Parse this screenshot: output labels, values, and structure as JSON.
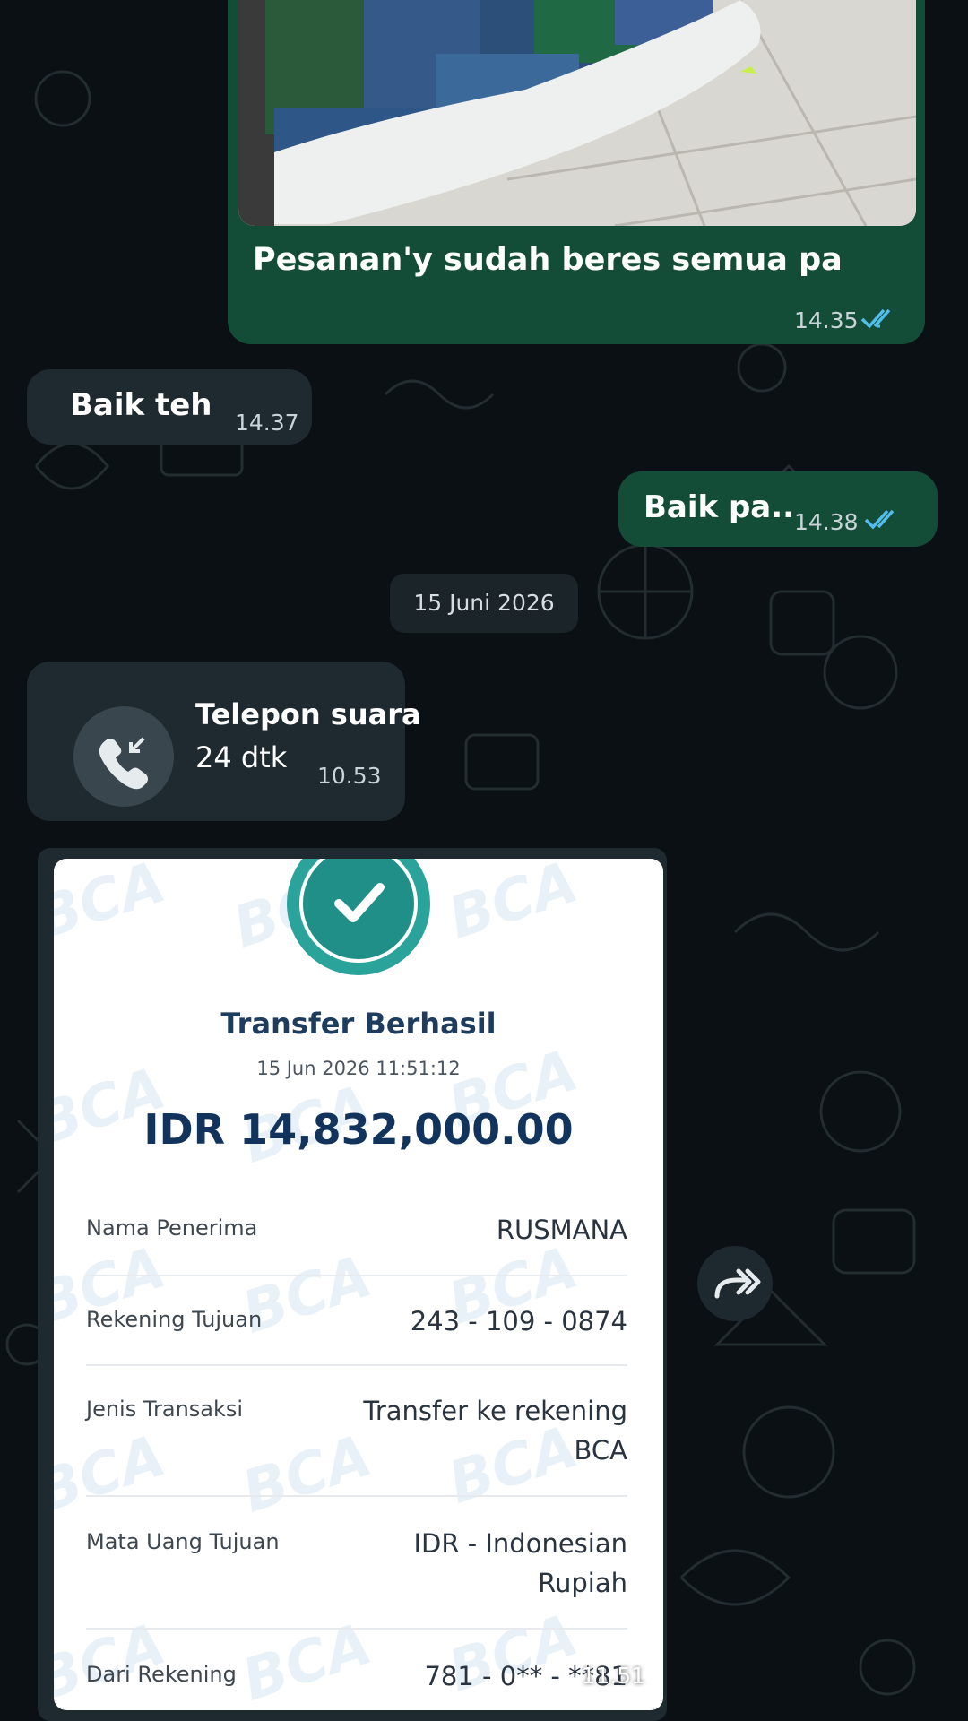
{
  "messages": {
    "photo_caption": {
      "text": "Pesanan'y sudah beres semua pa",
      "time": "14.35"
    },
    "reply_1": {
      "text": "Baik teh",
      "time": "14.37"
    },
    "reply_2": {
      "text": "Baik pa..",
      "time": "14.38"
    }
  },
  "date_separator": "15 Juni 2026",
  "call": {
    "title": "Telepon suara",
    "duration": "24 dtk",
    "time": "10.53"
  },
  "receipt": {
    "watermark": "BCA",
    "status": "Transfer Berhasil",
    "datetime": "15 Jun 2026 11:51:12",
    "amount": "IDR 14,832,000.00",
    "rows": [
      {
        "label": "Nama Penerima",
        "value": "RUSMANA"
      },
      {
        "label": "Rekening Tujuan",
        "value": "243 - 109 - 0874"
      },
      {
        "label": "Jenis Transaksi",
        "value": "Transfer ke rekening\nBCA"
      },
      {
        "label": "Mata Uang Tujuan",
        "value": "IDR - Indonesian\nRupiah"
      },
      {
        "label": "Dari Rekening",
        "value": "781 - 0** - **81"
      }
    ],
    "time": "11.51"
  },
  "icons": {
    "read_receipt": "double-check-icon",
    "call": "incoming-call-icon",
    "success": "check-circle-icon",
    "forward": "forward-icon"
  },
  "colors": {
    "outgoing_bubble": "#144d37",
    "incoming_bubble": "#1f2a30",
    "read_tick": "#53bdeb",
    "success_badge": "#2aa39b"
  }
}
